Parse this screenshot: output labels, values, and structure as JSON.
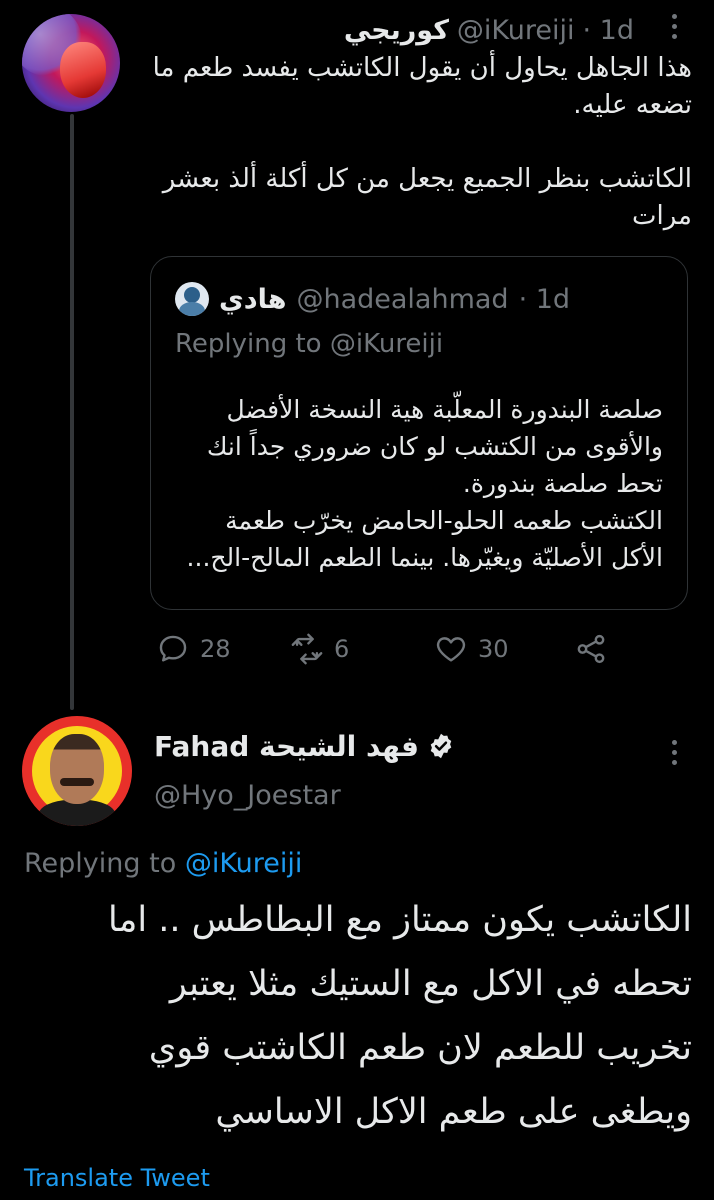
{
  "tweet1": {
    "display_name": "كوريجي",
    "handle": "@iKureiji",
    "time": "· 1d",
    "text": "هذا الجاهل يحاول أن يقول الكاتشب يفسد طعم ما\nتضعه عليه.\n\nالكاتشب بنظر الجميع يجعل من كل أكلة ألذ بعشر\nمرات",
    "quote": {
      "display_name": "هادي",
      "handle": "@hadealahmad",
      "time": "· 1d",
      "replying_prefix": "Replying to",
      "replying_handle": "@iKureiji",
      "text": "صلصة البندورة المعلّبة هية النسخة الأفضل\nوالأقوى من الكتشب لو كان ضروري جداً انك\nتحط صلصة بندورة.\nالكتشب طعمه الحلو-الحامض يخرّب طعمة\nالأكل الأصليّة ويغيّرها. بينما الطعم المالح-الح..."
    },
    "actions": {
      "replies": "28",
      "retweets": "6",
      "likes": "30"
    }
  },
  "tweet2": {
    "display_name": "Fahad فهد الشيحة",
    "handle": "@Hyo_Joestar",
    "replying_prefix": "Replying to",
    "replying_handle": "@iKureiji",
    "text": "الكاتشب يكون ممتاز مع البطاطس .. اما\nتحطه في الاكل مع الستيك مثلا يعتبر\nتخريب للطعم لان طعم الكاشتب قوي\nويطغى على طعم الاكل الاساسي",
    "translate_label": "Translate Tweet"
  },
  "colors": {
    "background": "#000000",
    "text_primary": "#e7e9ea",
    "text_muted": "#71767b",
    "link": "#1d9bf0",
    "border": "#2f3336"
  }
}
